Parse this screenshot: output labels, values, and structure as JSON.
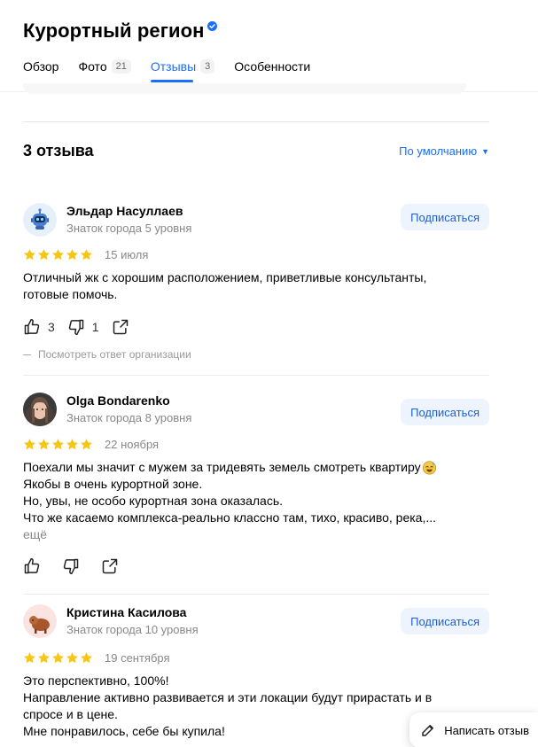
{
  "header": {
    "title": "Курортный регион",
    "tabs": [
      {
        "label": "Обзор",
        "count": ""
      },
      {
        "label": "Фото",
        "count": "21"
      },
      {
        "label": "Отзывы",
        "count": "3"
      },
      {
        "label": "Особенности",
        "count": ""
      }
    ]
  },
  "reviews": {
    "heading": "3 отзыва",
    "sort_label": "По умолчанию",
    "items": [
      {
        "author": "Эльдар Насуллаев",
        "level": "Знаток города 5 уровня",
        "subscribe": "Подписаться",
        "rating": 5,
        "date": "15 июля",
        "lines": [
          "Отличный жк с хорошим расположением, приветливые консультанты,",
          "готовые помочь."
        ],
        "likes": "3",
        "dislikes": "1",
        "org_answer": "Посмотреть ответ организации"
      },
      {
        "author": "Olga Bondarenko",
        "level": "Знаток города 8 уровня",
        "subscribe": "Подписаться",
        "rating": 5,
        "date": "22 ноября",
        "lines": [
          "Поехали мы значит с мужем за тридевять земель смотреть квартиру",
          "Якобы в очень курортной зоне.",
          "Но, увы, не особо курортная зона оказалась.",
          "Что же касаемо комплекса-реально классно там, тихо, красиво, река,..."
        ],
        "more": "ещё"
      },
      {
        "author": "Кристина Касилова",
        "level": "Знаток города 10 уровня",
        "subscribe": "Подписаться",
        "rating": 5,
        "date": "19 сентября",
        "lines": [
          "Это перспективно, 100%!",
          "Направление активно развивается и эти локации будут прирастать и в",
          "спросе и в цене.",
          "Мне понравилось, себе бы купила!"
        ]
      }
    ]
  },
  "write_review": "Написать отзыв",
  "colors": {
    "accent": "#1a6dff",
    "star": "#f5c518",
    "subscribe_bg": "#eef4fd"
  }
}
